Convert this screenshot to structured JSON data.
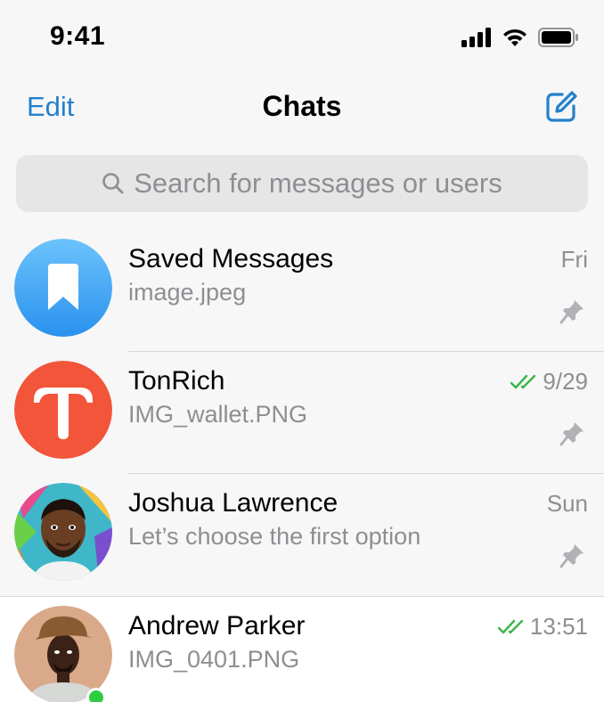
{
  "status_bar": {
    "time": "9:41"
  },
  "nav": {
    "edit_label": "Edit",
    "title": "Chats"
  },
  "search": {
    "placeholder": "Search for messages or users"
  },
  "chats": [
    {
      "name": "Saved Messages",
      "preview": "image.jpeg",
      "time": "Fri",
      "pinned": true,
      "read_receipt": false,
      "avatar": "bookmark-icon",
      "avatar_color": "#2a9bf0"
    },
    {
      "name": "TonRich",
      "preview": "IMG_wallet.PNG",
      "time": "9/29",
      "pinned": true,
      "read_receipt": true,
      "avatar": "tonrich-logo",
      "avatar_color": "#f2553a"
    },
    {
      "name": "Joshua Lawrence",
      "preview": "Let’s choose the first option",
      "time": "Sun",
      "pinned": true,
      "read_receipt": false,
      "avatar": "user-photo"
    },
    {
      "name": "Andrew Parker",
      "preview": "IMG_0401.PNG",
      "time": "13:51",
      "pinned": false,
      "read_receipt": true,
      "online": true,
      "avatar": "user-photo"
    }
  ],
  "colors": {
    "accent": "#2481cc",
    "read_check": "#3ab54a",
    "online": "#2ecc40"
  }
}
